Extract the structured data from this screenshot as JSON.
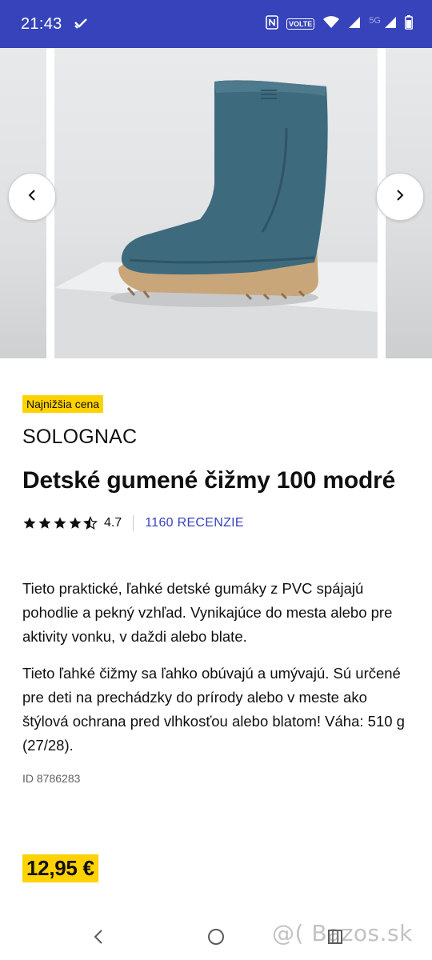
{
  "status_bar": {
    "time": "21:43",
    "left_icon": "tasks-icon",
    "right_icons": [
      "nfc-icon",
      "volte-badge",
      "wifi-icon",
      "signal-icon",
      "5g-signal-icon",
      "battery-icon"
    ],
    "volte_label": "VOLTE",
    "network_label": "5G",
    "background": "#3643ba"
  },
  "carousel": {
    "prev_icon": "chevron-left-icon",
    "next_icon": "chevron-right-icon",
    "image": "blue-rubber-boot-image"
  },
  "product": {
    "badge": "Najnižšia cena",
    "brand": "SOLOGNAC",
    "title": "Detské gumené čižmy 100 modré",
    "rating_value": "4.7",
    "rating_stars": 4.5,
    "reviews_label": "1160 RECENZIE",
    "description": [
      "Tieto praktické, ľahké detské gumáky z PVC spájajú pohodlie a pekný vzhľad. Vynikajúce do mesta alebo pre aktivity vonku, v daždi alebo blate.",
      "Tieto ľahké čižmy sa ľahko obúvajú a umývajú. Sú určené pre deti na prechádzky do prírody alebo v meste ako štýlová ochrana pred vlhkosťou alebo blatom! Váha: 510 g (27/28)."
    ],
    "id_label": "ID 8786283",
    "price": "12,95 €"
  },
  "colors": {
    "accent": "#3643ba",
    "badge_yellow": "#ffd200"
  },
  "bottom_nav": {
    "icons": [
      "back-nav-icon",
      "home-nav-icon",
      "recents-nav-icon"
    ]
  },
  "watermark": "@( Bazos.sk"
}
